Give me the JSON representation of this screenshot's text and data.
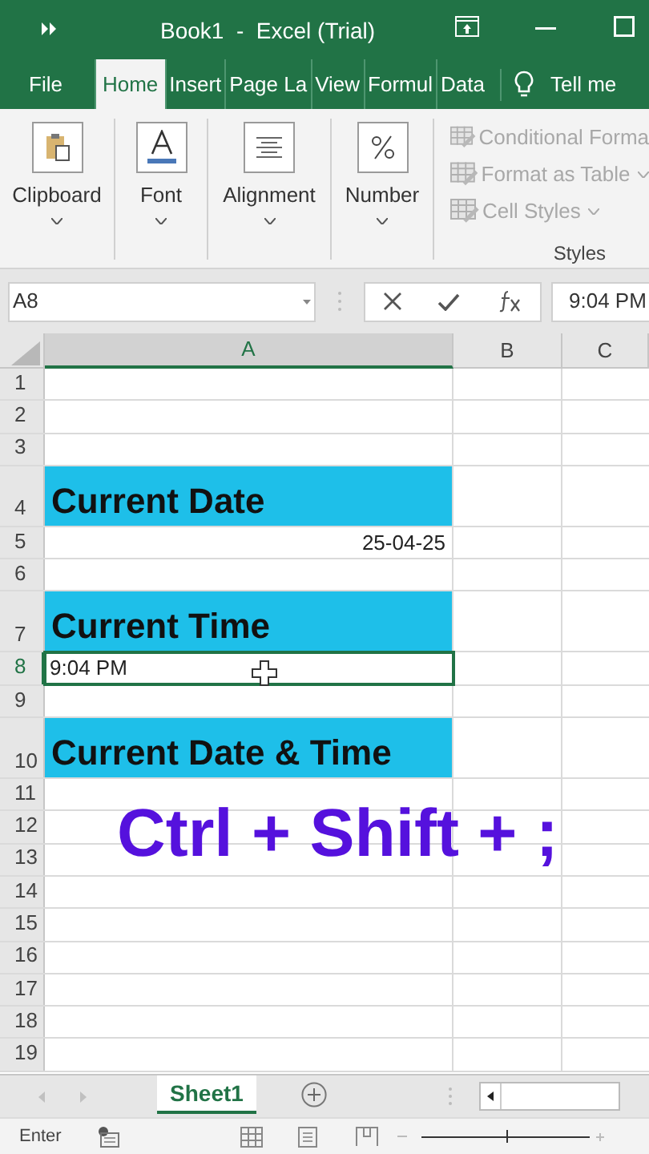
{
  "window": {
    "title": "Book1  -  Excel (Trial)"
  },
  "ribbon_tabs": [
    {
      "label": "File",
      "selected": false
    },
    {
      "label": "Home",
      "selected": true
    },
    {
      "label": "Insert",
      "selected": false
    },
    {
      "label": "Page La",
      "selected": false
    },
    {
      "label": "View",
      "selected": false
    },
    {
      "label": "Formul",
      "selected": false
    },
    {
      "label": "Data",
      "selected": false
    }
  ],
  "tell_me": "Tell me",
  "ribbon_groups": [
    {
      "label": "Clipboard",
      "kind": "clipboard"
    },
    {
      "label": "Font",
      "kind": "font"
    },
    {
      "label": "Alignment",
      "kind": "alignment"
    },
    {
      "label": "Number",
      "kind": "number"
    }
  ],
  "styles_group": {
    "label": "Styles",
    "items": [
      {
        "label": "Conditional Forma",
        "caret": false
      },
      {
        "label": "Format as Table",
        "caret": true
      },
      {
        "label": "Cell Styles",
        "caret": true
      }
    ]
  },
  "name_box": "A8",
  "formula_value": "9:04 PM",
  "columns": [
    {
      "label": "A",
      "selected": true
    },
    {
      "label": "B",
      "selected": false
    },
    {
      "label": "C",
      "selected": false
    }
  ],
  "rows": [
    {
      "number": "1",
      "selected": false,
      "tall": false
    },
    {
      "number": "2",
      "selected": false,
      "tall": false
    },
    {
      "number": "3",
      "selected": false,
      "tall": false
    },
    {
      "number": "4",
      "selected": false,
      "tall": true,
      "cell": {
        "text": "Current Date",
        "kind": "heading"
      }
    },
    {
      "number": "5",
      "selected": false,
      "tall": false,
      "cell": {
        "text": "25-04-25",
        "kind": "date"
      }
    },
    {
      "number": "6",
      "selected": false,
      "tall": false
    },
    {
      "number": "7",
      "selected": false,
      "tall": true,
      "cell": {
        "text": "Current Time",
        "kind": "heading"
      }
    },
    {
      "number": "8",
      "selected": true,
      "tall": false,
      "cell": {
        "text": "9:04 PM",
        "kind": "text"
      }
    },
    {
      "number": "9",
      "selected": false,
      "tall": false
    },
    {
      "number": "10",
      "selected": false,
      "tall": true,
      "cell": {
        "text": "Current Date & Time",
        "kind": "heading"
      }
    },
    {
      "number": "11",
      "selected": false,
      "tall": false
    },
    {
      "number": "12",
      "selected": false,
      "tall": false
    },
    {
      "number": "13",
      "selected": false,
      "tall": false
    },
    {
      "number": "14",
      "selected": false,
      "tall": false
    },
    {
      "number": "15",
      "selected": false,
      "tall": false
    },
    {
      "number": "16",
      "selected": false,
      "tall": false
    },
    {
      "number": "17",
      "selected": false,
      "tall": false
    },
    {
      "number": "18",
      "selected": false,
      "tall": false
    },
    {
      "number": "19",
      "selected": false,
      "tall": false
    }
  ],
  "caption": "Ctrl + Shift + ;",
  "sheet_tabs": [
    {
      "label": "Sheet1",
      "selected": true
    }
  ],
  "status": "Enter",
  "zoom": {
    "level": 0.5
  }
}
